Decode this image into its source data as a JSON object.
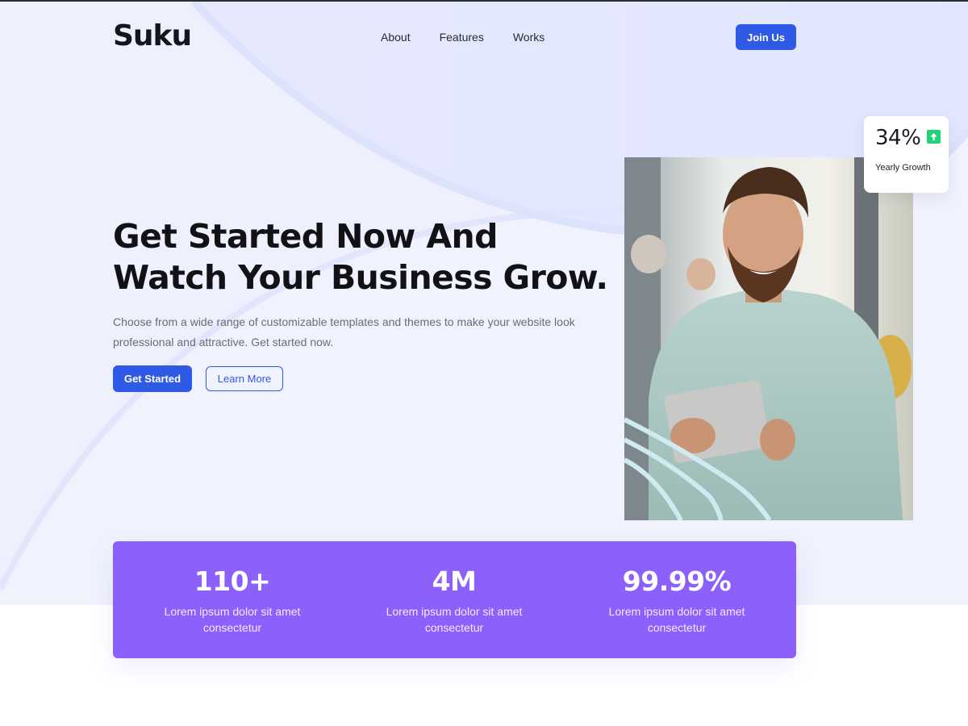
{
  "brand": {
    "logo": "Suku"
  },
  "nav": {
    "items": [
      "About",
      "Features",
      "Works"
    ],
    "cta": "Join Us"
  },
  "hero": {
    "headline": "Get Started Now And Watch Your Business Grow.",
    "subtext": "Choose from a wide range of customizable templates and themes to make your website look professional and attractive. Get started now.",
    "primary_button": "Get Started",
    "secondary_button": "Learn More",
    "photo_alt": "Smiling bearded man holding a tablet"
  },
  "growth_card": {
    "value": "34%",
    "label": "Yearly Growth",
    "icon": "arrow-up-icon",
    "icon_color": "#22d17a"
  },
  "stats": [
    {
      "value": "110+",
      "desc": "Lorem ipsum dolor sit amet consectetur"
    },
    {
      "value": "4M",
      "desc": "Lorem ipsum dolor sit amet consectetur"
    },
    {
      "value": "99.99%",
      "desc": "Lorem ipsum dolor sit amet consectetur"
    }
  ],
  "colors": {
    "accent": "#2f5ae6",
    "stats_bg": "#8c60fb",
    "hero_bg": "#eef0fd"
  }
}
